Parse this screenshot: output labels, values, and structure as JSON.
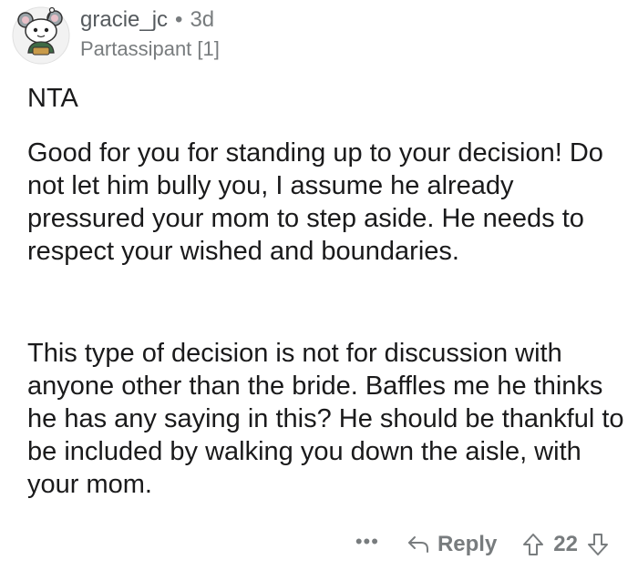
{
  "comment": {
    "username": "gracie_jc",
    "separator": "•",
    "age": "3d",
    "flair": "Partassipant [1]",
    "avatar_icon": "snoo-avatar-icon",
    "paragraphs": [
      "NTA",
      "Good for you for standing up to your decision! Do not let him bully you, I assume he already pressured your mom to step aside. He needs to respect your wished and boundaries.",
      "This type of decision is not for discussion with anyone other than the bride. Baffles me he thinks he has any saying in this? He should be thankful to be included by walking you down the aisle, with your mom."
    ]
  },
  "actions": {
    "more_label": "•••",
    "reply_label": "Reply",
    "score": "22",
    "icons": [
      "more-icon",
      "reply-arrow-icon",
      "upvote-icon",
      "downvote-icon"
    ]
  },
  "colors": {
    "text": "#1a1a1b",
    "meta": "#787c7e",
    "username": "#555a5e"
  }
}
